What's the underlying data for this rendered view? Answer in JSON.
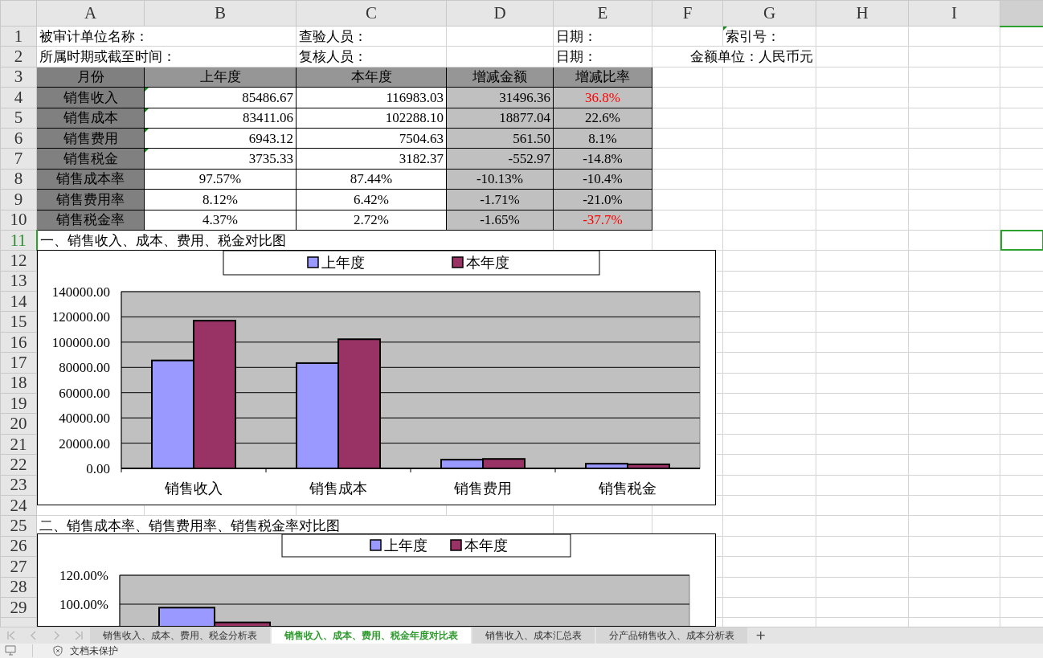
{
  "column_headers": [
    "A",
    "B",
    "C",
    "D",
    "E",
    "F",
    "G",
    "H",
    "I"
  ],
  "row_headers": [
    {
      "label": "1",
      "selected": false
    },
    {
      "label": "2",
      "selected": false
    },
    {
      "label": "3",
      "selected": false
    },
    {
      "label": "4",
      "selected": false
    },
    {
      "label": "5",
      "selected": false
    },
    {
      "label": "6",
      "selected": false
    },
    {
      "label": "7",
      "selected": false
    },
    {
      "label": "8",
      "selected": false
    },
    {
      "label": "9",
      "selected": false
    },
    {
      "label": "10",
      "selected": false
    },
    {
      "label": "11",
      "selected": true
    },
    {
      "label": "12",
      "selected": false
    },
    {
      "label": "13",
      "selected": false
    },
    {
      "label": "14",
      "selected": false
    },
    {
      "label": "15",
      "selected": false
    },
    {
      "label": "16",
      "selected": false
    },
    {
      "label": "17",
      "selected": false
    },
    {
      "label": "18",
      "selected": false
    },
    {
      "label": "19",
      "selected": false
    },
    {
      "label": "20",
      "selected": false
    },
    {
      "label": "21",
      "selected": false
    },
    {
      "label": "22",
      "selected": false
    },
    {
      "label": "23",
      "selected": false
    },
    {
      "label": "24",
      "selected": false
    },
    {
      "label": "25",
      "selected": false
    },
    {
      "label": "26",
      "selected": false
    },
    {
      "label": "27",
      "selected": false
    },
    {
      "label": "28",
      "selected": false
    },
    {
      "label": "29",
      "selected": false
    }
  ],
  "header_fields": [
    {
      "text": "被审计单位名称：",
      "flag": false
    },
    {
      "text": "查验人员：",
      "flag": false
    },
    {
      "text": "日期：",
      "flag": false
    },
    {
      "text": "索引号：",
      "flag": true
    },
    {
      "text": "所属时期或截至时间：",
      "flag": false
    },
    {
      "text": "复核人员：",
      "flag": false
    },
    {
      "text": "日期：",
      "flag": false
    },
    {
      "text": "金额单位：人民币元",
      "flag": false
    }
  ],
  "table": {
    "columns": [
      "月份",
      "上年度",
      "本年度",
      "增减金额",
      "增减比率"
    ],
    "rows": [
      {
        "kind": "amount",
        "flag": true,
        "month": "销售收入",
        "last_year": "85486.67",
        "this_year": "116983.03",
        "change": "31496.36",
        "change_rate": "36.8%",
        "alert": true
      },
      {
        "kind": "amount",
        "flag": true,
        "month": "销售成本",
        "last_year": "83411.06",
        "this_year": "102288.10",
        "change": "18877.04",
        "change_rate": "22.6%",
        "alert": false
      },
      {
        "kind": "amount",
        "flag": true,
        "month": "销售费用",
        "last_year": "6943.12",
        "this_year": "7504.63",
        "change": "561.50",
        "change_rate": "8.1%",
        "alert": false
      },
      {
        "kind": "amount",
        "flag": true,
        "month": "销售税金",
        "last_year": "3735.33",
        "this_year": "3182.37",
        "change": "-552.97",
        "change_rate": "-14.8%",
        "alert": false
      },
      {
        "kind": "rate",
        "flag": false,
        "month": "销售成本率",
        "last_year": "97.57%",
        "this_year": "87.44%",
        "change": "-10.13%",
        "change_rate": "-10.4%",
        "alert": false
      },
      {
        "kind": "rate",
        "flag": false,
        "month": "销售费用率",
        "last_year": "8.12%",
        "this_year": "6.42%",
        "change": "-1.71%",
        "change_rate": "-21.0%",
        "alert": false
      },
      {
        "kind": "rate",
        "flag": false,
        "month": "销售税金率",
        "last_year": "4.37%",
        "this_year": "2.72%",
        "change": "-1.65%",
        "change_rate": "-37.7%",
        "alert": true
      }
    ]
  },
  "charts": [
    {
      "title": "一、销售收入、成本、费用、税金对比图",
      "chart_data": {
        "type": "bar",
        "categories": [
          "销售收入",
          "销售成本",
          "销售费用",
          "销售税金"
        ],
        "series": [
          {
            "name": "上年度",
            "color": "#9999ff",
            "values": [
              85500,
              83400,
              6900,
              3700
            ]
          },
          {
            "name": "本年度",
            "color": "#993366",
            "values": [
              117000,
              102300,
              7500,
              3200
            ]
          }
        ],
        "ylim": [
          0,
          140000
        ],
        "grid": true,
        "legend": true,
        "yticks": [
          {
            "value": 0,
            "label": "0.00"
          },
          {
            "value": 20000,
            "label": "20000.00"
          },
          {
            "value": 40000,
            "label": "40000.00"
          },
          {
            "value": 60000,
            "label": "60000.00"
          },
          {
            "value": 80000,
            "label": "80000.00"
          },
          {
            "value": 100000,
            "label": "100000.00"
          },
          {
            "value": 120000,
            "label": "120000.00"
          },
          {
            "value": 140000,
            "label": "140000.00"
          }
        ]
      }
    },
    {
      "title": "二、销售成本率、销售费用率、销售税金率对比图",
      "chart_data": {
        "type": "bar",
        "series": [
          {
            "name": "上年度",
            "color": "#9999ff",
            "values": [
              97.6
            ]
          },
          {
            "name": "本年度",
            "color": "#993366",
            "values": [
              87.4
            ]
          }
        ],
        "ylim": [
          0,
          120
        ],
        "grid": true,
        "legend": true,
        "yticks": [
          {
            "value": 100,
            "label": "100.00%"
          },
          {
            "value": 120,
            "label": "120.00%"
          }
        ]
      }
    }
  ],
  "sheet_tabs": [
    {
      "label": "销售收入、成本、费用、税金分析表",
      "selected": false
    },
    {
      "label": "销售收入、成本、费用、税金年度对比表",
      "selected": true
    },
    {
      "label": "销售收入、成本汇总表",
      "selected": false
    },
    {
      "label": "分产品销售收入、成本分析表",
      "selected": false
    }
  ],
  "add_sheet": "+",
  "status_bar": {
    "protection": "文档未保护"
  }
}
